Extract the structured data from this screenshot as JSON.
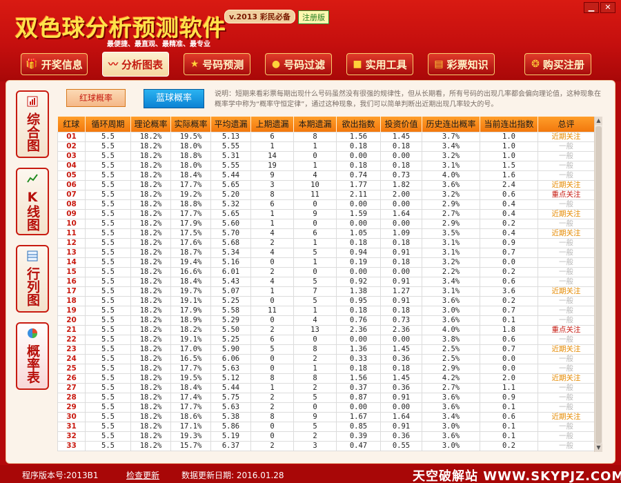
{
  "app": {
    "title": "双色球分析预测软件",
    "version_badge": "v.2013 彩民必备",
    "reg_badge": "注册版",
    "tagline": "最便捷、最直观、最精准、最专业"
  },
  "window": {
    "minimize": "▁",
    "close": "✕"
  },
  "nav": [
    {
      "label": "开奖信息",
      "icon": "🎁"
    },
    {
      "label": "分析图表",
      "icon": "〰"
    },
    {
      "label": "号码预测",
      "icon": "★"
    },
    {
      "label": "号码过滤",
      "icon": "●"
    },
    {
      "label": "实用工具",
      "icon": "■"
    },
    {
      "label": "彩票知识",
      "icon": "▤"
    },
    {
      "label": "购买注册",
      "icon": "❂"
    }
  ],
  "side_tabs": [
    {
      "label": "综合图",
      "icon": "chart-icon"
    },
    {
      "label": "K线图",
      "icon": "k-line-icon"
    },
    {
      "label": "行列图",
      "icon": "grid-icon"
    },
    {
      "label": "概率表",
      "icon": "pie-icon"
    }
  ],
  "buttons": {
    "red": "红球概率",
    "blue": "蓝球概率"
  },
  "note": "说明：短期来看彩票每期出现什么号码虽然没有很强的规律性，但从长期看，所有号码的出现几率都会偏向理论值，这种现象在概率学中称为“概率守恒定律”，通过这种现象，我们可以简单判断出近期出现几率较大的号。",
  "table": {
    "headers": [
      "红球",
      "循环周期",
      "理论概率",
      "实际概率",
      "平均遗漏",
      "上期遗漏",
      "本期遗漏",
      "欲出指数",
      "投资价值",
      "历史连出概率",
      "当前连出指数",
      "总评"
    ],
    "rows": [
      [
        "01",
        "5.5",
        "18.2%",
        "19.5%",
        "5.13",
        "6",
        "8",
        "1.56",
        "1.45",
        "3.7%",
        "1.0",
        "近期关注"
      ],
      [
        "02",
        "5.5",
        "18.2%",
        "18.0%",
        "5.55",
        "1",
        "1",
        "0.18",
        "0.18",
        "3.4%",
        "1.0",
        "一般"
      ],
      [
        "03",
        "5.5",
        "18.2%",
        "18.8%",
        "5.31",
        "14",
        "0",
        "0.00",
        "0.00",
        "3.2%",
        "1.0",
        "一般"
      ],
      [
        "04",
        "5.5",
        "18.2%",
        "18.0%",
        "5.55",
        "19",
        "1",
        "0.18",
        "0.18",
        "3.1%",
        "1.5",
        "一般"
      ],
      [
        "05",
        "5.5",
        "18.2%",
        "18.4%",
        "5.44",
        "9",
        "4",
        "0.74",
        "0.73",
        "4.0%",
        "1.6",
        "一般"
      ],
      [
        "06",
        "5.5",
        "18.2%",
        "17.7%",
        "5.65",
        "3",
        "10",
        "1.77",
        "1.82",
        "3.6%",
        "2.4",
        "近期关注"
      ],
      [
        "07",
        "5.5",
        "18.2%",
        "19.2%",
        "5.20",
        "8",
        "11",
        "2.11",
        "2.00",
        "3.2%",
        "0.6",
        "重点关注"
      ],
      [
        "08",
        "5.5",
        "18.2%",
        "18.8%",
        "5.32",
        "6",
        "0",
        "0.00",
        "0.00",
        "2.9%",
        "0.4",
        "一般"
      ],
      [
        "09",
        "5.5",
        "18.2%",
        "17.7%",
        "5.65",
        "1",
        "9",
        "1.59",
        "1.64",
        "2.7%",
        "0.4",
        "近期关注"
      ],
      [
        "10",
        "5.5",
        "18.2%",
        "17.9%",
        "5.60",
        "1",
        "0",
        "0.00",
        "0.00",
        "2.9%",
        "0.2",
        "一般"
      ],
      [
        "11",
        "5.5",
        "18.2%",
        "17.5%",
        "5.70",
        "4",
        "6",
        "1.05",
        "1.09",
        "3.5%",
        "0.4",
        "近期关注"
      ],
      [
        "12",
        "5.5",
        "18.2%",
        "17.6%",
        "5.68",
        "2",
        "1",
        "0.18",
        "0.18",
        "3.1%",
        "0.9",
        "一般"
      ],
      [
        "13",
        "5.5",
        "18.2%",
        "18.7%",
        "5.34",
        "4",
        "5",
        "0.94",
        "0.91",
        "3.1%",
        "0.7",
        "一般"
      ],
      [
        "14",
        "5.5",
        "18.2%",
        "19.4%",
        "5.16",
        "0",
        "1",
        "0.19",
        "0.18",
        "3.2%",
        "0.0",
        "一般"
      ],
      [
        "15",
        "5.5",
        "18.2%",
        "16.6%",
        "6.01",
        "2",
        "0",
        "0.00",
        "0.00",
        "2.2%",
        "0.2",
        "一般"
      ],
      [
        "16",
        "5.5",
        "18.2%",
        "18.4%",
        "5.43",
        "4",
        "5",
        "0.92",
        "0.91",
        "3.4%",
        "0.6",
        "一般"
      ],
      [
        "17",
        "5.5",
        "18.2%",
        "19.7%",
        "5.07",
        "1",
        "7",
        "1.38",
        "1.27",
        "3.1%",
        "3.6",
        "近期关注"
      ],
      [
        "18",
        "5.5",
        "18.2%",
        "19.1%",
        "5.25",
        "0",
        "5",
        "0.95",
        "0.91",
        "3.6%",
        "0.2",
        "一般"
      ],
      [
        "19",
        "5.5",
        "18.2%",
        "17.9%",
        "5.58",
        "11",
        "1",
        "0.18",
        "0.18",
        "3.0%",
        "0.7",
        "一般"
      ],
      [
        "20",
        "5.5",
        "18.2%",
        "18.9%",
        "5.29",
        "0",
        "4",
        "0.76",
        "0.73",
        "3.6%",
        "0.1",
        "一般"
      ],
      [
        "21",
        "5.5",
        "18.2%",
        "18.2%",
        "5.50",
        "2",
        "13",
        "2.36",
        "2.36",
        "4.0%",
        "1.8",
        "重点关注"
      ],
      [
        "22",
        "5.5",
        "18.2%",
        "19.1%",
        "5.25",
        "6",
        "0",
        "0.00",
        "0.00",
        "3.8%",
        "0.6",
        "一般"
      ],
      [
        "23",
        "5.5",
        "18.2%",
        "17.0%",
        "5.90",
        "5",
        "8",
        "1.36",
        "1.45",
        "2.5%",
        "0.7",
        "近期关注"
      ],
      [
        "24",
        "5.5",
        "18.2%",
        "16.5%",
        "6.06",
        "0",
        "2",
        "0.33",
        "0.36",
        "2.5%",
        "0.0",
        "一般"
      ],
      [
        "25",
        "5.5",
        "18.2%",
        "17.7%",
        "5.63",
        "0",
        "1",
        "0.18",
        "0.18",
        "2.9%",
        "0.0",
        "一般"
      ],
      [
        "26",
        "5.5",
        "18.2%",
        "19.5%",
        "5.12",
        "8",
        "8",
        "1.56",
        "1.45",
        "4.2%",
        "2.0",
        "近期关注"
      ],
      [
        "27",
        "5.5",
        "18.2%",
        "18.4%",
        "5.44",
        "1",
        "2",
        "0.37",
        "0.36",
        "2.7%",
        "1.1",
        "一般"
      ],
      [
        "28",
        "5.5",
        "18.2%",
        "17.4%",
        "5.75",
        "2",
        "5",
        "0.87",
        "0.91",
        "3.6%",
        "0.9",
        "一般"
      ],
      [
        "29",
        "5.5",
        "18.2%",
        "17.7%",
        "5.63",
        "2",
        "0",
        "0.00",
        "0.00",
        "3.6%",
        "0.1",
        "一般"
      ],
      [
        "30",
        "5.5",
        "18.2%",
        "18.6%",
        "5.38",
        "8",
        "9",
        "1.67",
        "1.64",
        "3.4%",
        "0.6",
        "近期关注"
      ],
      [
        "31",
        "5.5",
        "18.2%",
        "17.1%",
        "5.86",
        "0",
        "5",
        "0.85",
        "0.91",
        "3.0%",
        "0.1",
        "一般"
      ],
      [
        "32",
        "5.5",
        "18.2%",
        "19.3%",
        "5.19",
        "0",
        "2",
        "0.39",
        "0.36",
        "3.6%",
        "0.1",
        "一般"
      ],
      [
        "33",
        "5.5",
        "18.2%",
        "15.7%",
        "6.37",
        "2",
        "3",
        "0.47",
        "0.55",
        "3.0%",
        "0.2",
        "一般"
      ]
    ]
  },
  "footer": {
    "version": "程序版本号:2013B1",
    "check_update": "检查更新",
    "data_date": "数据更新日期: 2016.01.28",
    "watermark": "天空破解站 WWW.SKYPJZ.COM"
  },
  "colors": {
    "brand_red": "#c50f0e",
    "header_orange": "#f2780d",
    "near_watch": "#e58a00",
    "key_watch": "#c61a10",
    "normal": "#b9b9b9"
  }
}
